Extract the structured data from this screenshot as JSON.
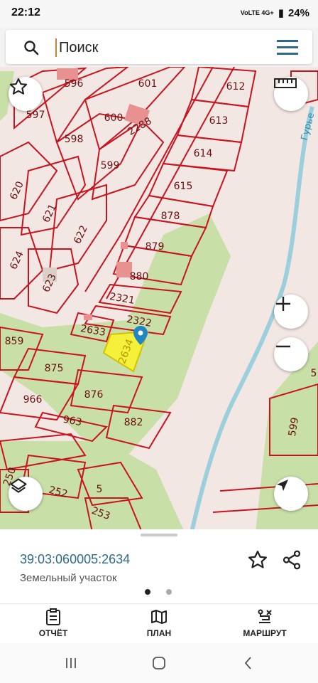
{
  "status_bar": {
    "time": "22:12",
    "battery": "24%",
    "network": "VoLTE 4G+"
  },
  "search": {
    "placeholder": "Поиск"
  },
  "map": {
    "parcels": [
      "596",
      "601",
      "612",
      "597",
      "600",
      "2288",
      "613",
      "598",
      "614",
      "599",
      "615",
      "620",
      "621",
      "878",
      "622",
      "879",
      "624",
      "623",
      "880",
      "2321",
      "2322",
      "2633",
      "2634",
      "859",
      "875",
      "876",
      "966",
      "963",
      "882",
      "250",
      "252",
      "5",
      "253",
      "599",
      "5"
    ],
    "selected_parcel": "2634",
    "river_label": "Гурье"
  },
  "parcel": {
    "cadastral_number": "39:03:060005:2634",
    "type": "Земельный участок"
  },
  "bottom_nav": [
    {
      "label": "ОТЧЁТ",
      "icon": "report-icon"
    },
    {
      "label": "ПЛАН",
      "icon": "map-plan-icon"
    },
    {
      "label": "МАРШРУТ",
      "icon": "route-icon"
    }
  ],
  "colors": {
    "accent": "#2e6b8a",
    "parcel_border": "#c8141e",
    "greenery": "#c8dfa8",
    "selected": "#f5f03a"
  }
}
